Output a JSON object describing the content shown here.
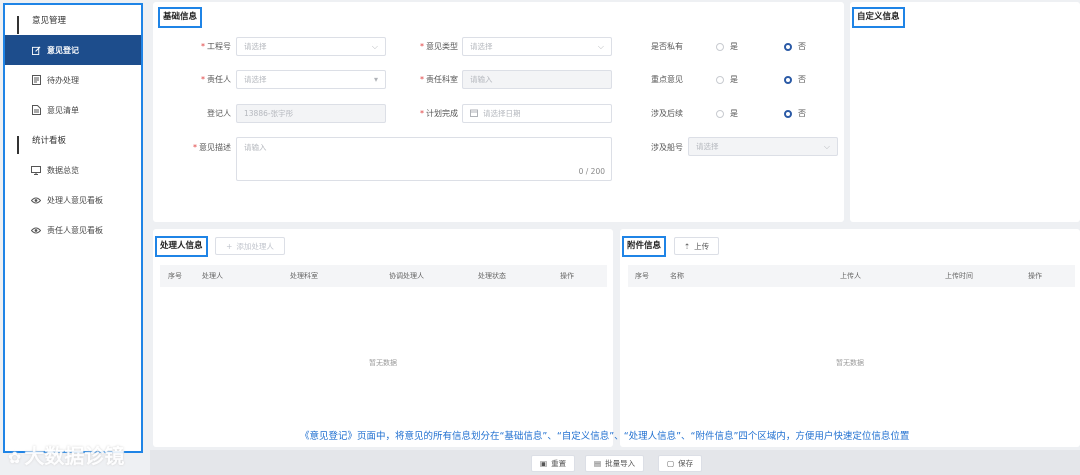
{
  "sidebar": {
    "group1": "意见管理",
    "items1": [
      "意见登记",
      "待办处理",
      "意见清单"
    ],
    "group2": "统计看板",
    "items2": [
      "数据总览",
      "处理人意见看板",
      "责任人意见看板"
    ]
  },
  "basic": {
    "title": "基础信息",
    "project_label": "工程号",
    "project_ph": "请选择",
    "type_label": "意见类型",
    "type_ph": "请选择",
    "private_label": "是否私有",
    "owner_label": "责任人",
    "owner_ph": "请选择",
    "dept_label": "责任科室",
    "dept_ph": "请输入",
    "key_label": "重点意见",
    "registrant_label": "登记人",
    "registrant_value": "13886-张宇彤",
    "plan_label": "计划完成",
    "plan_ph": "请选择日期",
    "subsequent_label": "涉及后续",
    "desc_label": "意见描述",
    "desc_ph": "请输入",
    "desc_count": "0 / 200",
    "ship_label": "涉及船号",
    "ship_ph": "请选择",
    "yes": "是",
    "no": "否"
  },
  "custom": {
    "title": "自定义信息"
  },
  "handler": {
    "title": "处理人信息",
    "add_btn": "添加处理人",
    "columns": [
      "序号",
      "处理人",
      "处理科室",
      "协调处理人",
      "处理状态",
      "操作"
    ],
    "empty": "暂无数据"
  },
  "attachment": {
    "title": "附件信息",
    "upload_btn": "上传",
    "columns": [
      "序号",
      "名称",
      "上传人",
      "上传时间",
      "操作"
    ],
    "empty": "暂无数据"
  },
  "caption": "《意见登记》页面中，将意见的所有信息划分在“基础信息”、“自定义信息”、“处理人信息”、“附件信息”四个区域内，方便用户快速定位信息位置",
  "footer": {
    "reset": "重置",
    "import": "批量导入",
    "save": "保存"
  },
  "watermark": "大数据诊镜"
}
